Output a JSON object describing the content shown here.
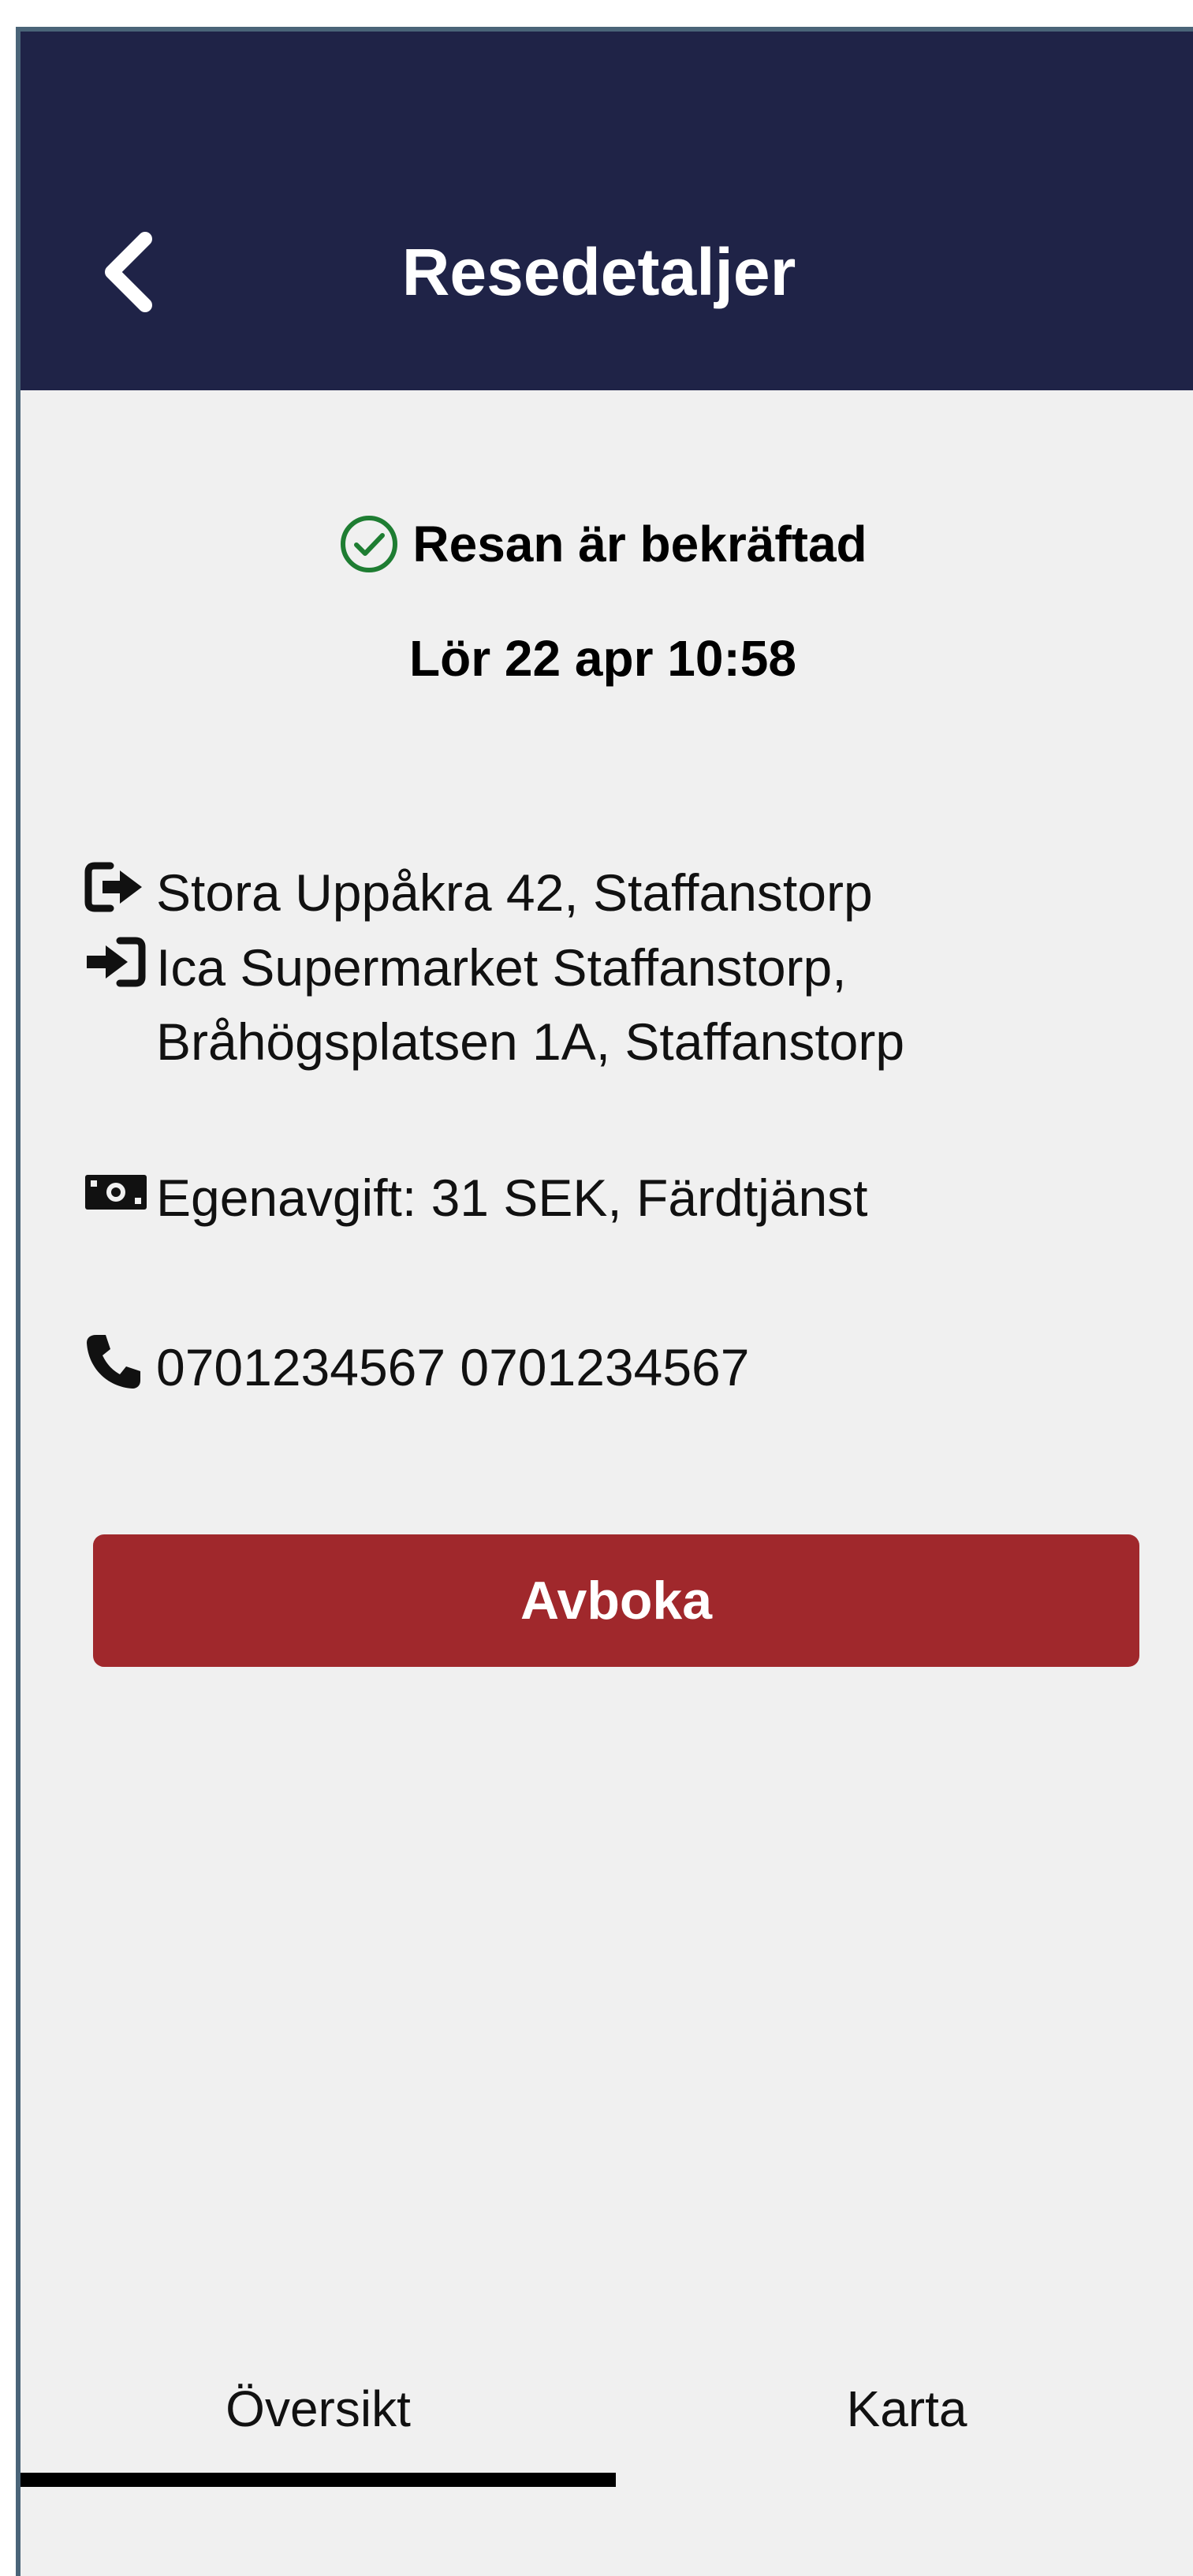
{
  "header": {
    "title": "Resedetaljer",
    "back_icon": "chevron-left-icon"
  },
  "status": {
    "text": "Resan är bekräftad",
    "icon": "check-circle-icon",
    "icon_color": "#1e7d32"
  },
  "datetime": "Lör 22 apr 10:58",
  "trip": {
    "from": "Stora Uppåkra 42, Staffanstorp",
    "to": "Ica Supermarket Staffanstorp,\nBråhögsplatsen 1A, Staffanstorp",
    "fee": "Egenavgift: 31 SEK, Färdtjänst",
    "phone": "0701234567 0701234567"
  },
  "actions": {
    "cancel_label": "Avboka",
    "cancel_color": "#a0282c"
  },
  "tabs": [
    {
      "label": "Översikt",
      "active": true
    },
    {
      "label": "Karta",
      "active": false
    }
  ],
  "colors": {
    "header_bg": "#1f2347",
    "page_bg": "#f0f0f0"
  }
}
